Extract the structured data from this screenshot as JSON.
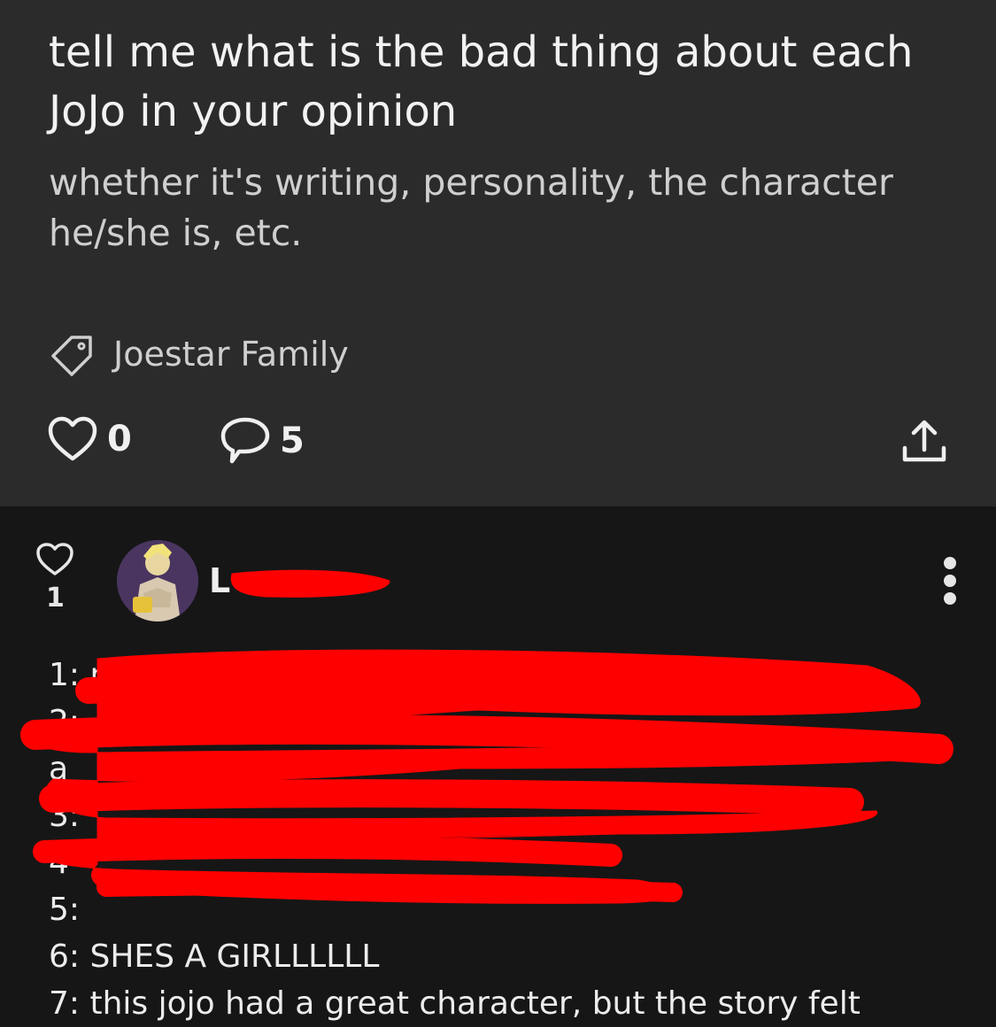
{
  "post": {
    "title": "tell me what is the bad thing about each JoJo in your opinion",
    "body": "whether it's writing, personality, the character he/she is, etc.",
    "tag": "Joestar Family",
    "likes": "0",
    "comments": "5"
  },
  "comment": {
    "likes": "1",
    "username": "L",
    "lines": [
      "1: n",
      "2:",
      "a",
      "3:",
      "4",
      "5:",
      "6: SHES A GIRLLLLLL",
      "7: this jojo had a great character, but the story felt"
    ]
  },
  "colors": {
    "post_bg": "#2b2b2b",
    "comment_bg": "#161616",
    "redaction": "#ff0000"
  }
}
